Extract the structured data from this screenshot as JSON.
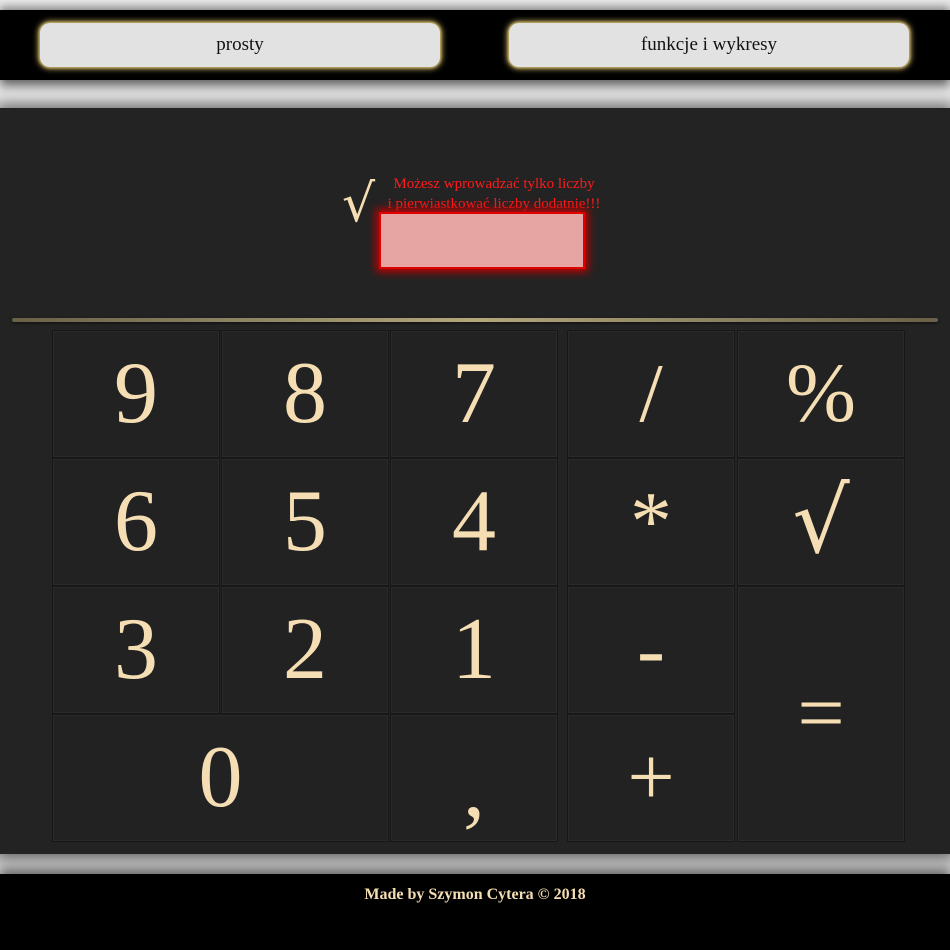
{
  "nav": {
    "tab_simple": "prosty",
    "tab_functions": "funkcje i wykresy"
  },
  "display": {
    "sqrt_symbol": "√",
    "error_line1": "Możesz wprowadzać tylko liczby",
    "error_line2": "i pierwiastkować liczby dodatnie!!!",
    "input_value": ""
  },
  "keys": {
    "k9": "9",
    "k8": "8",
    "k7": "7",
    "div": "/",
    "percent": "%",
    "k6": "6",
    "k5": "5",
    "k4": "4",
    "mul": "*",
    "sqrt": "√",
    "k3": "3",
    "k2": "2",
    "k1": "1",
    "minus": "-",
    "equals": "=",
    "k0": "0",
    "comma": ",",
    "plus": "+"
  },
  "footer": {
    "credit": "Made by Szymon Cytera © 2018"
  },
  "colors": {
    "accent_text": "#f5deb3",
    "error": "#ff1a1a",
    "panel": "#232323"
  }
}
